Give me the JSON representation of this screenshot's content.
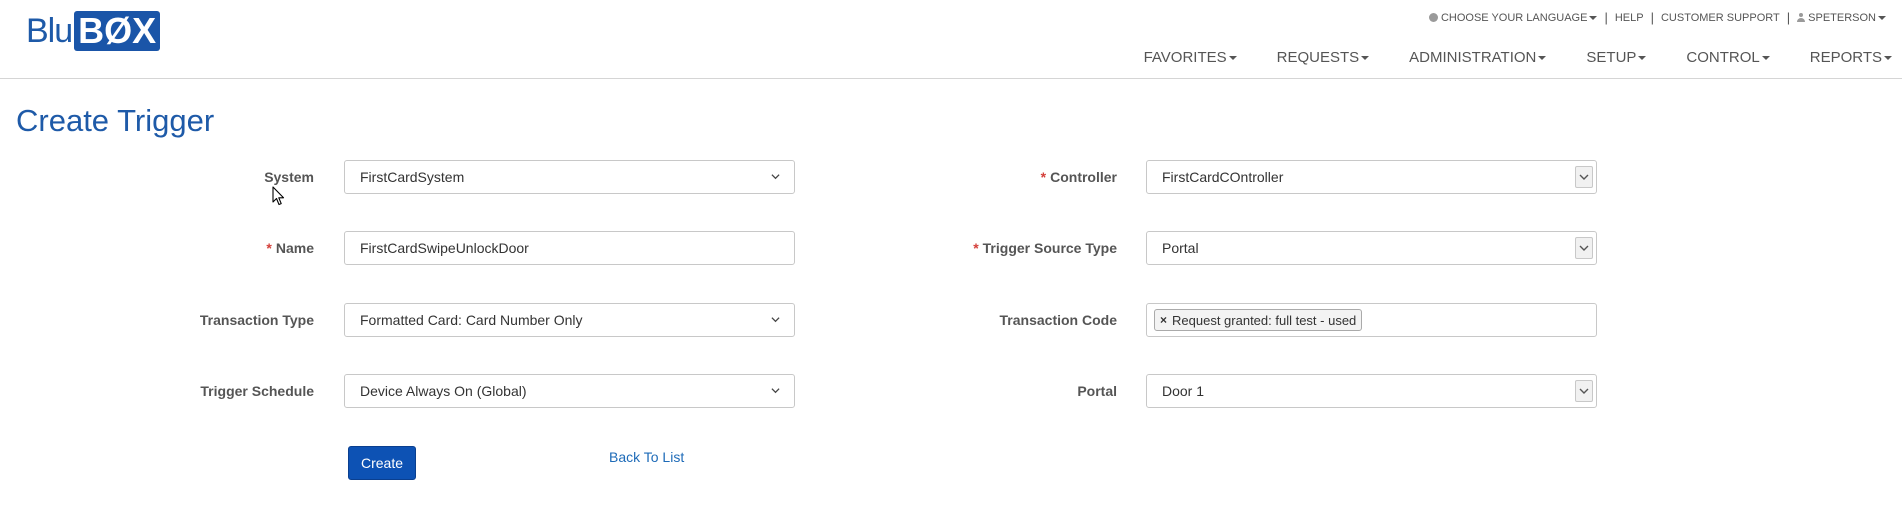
{
  "app": {
    "logo_left": "Blu",
    "logo_right": "BØX"
  },
  "utility_nav": {
    "language": "CHOOSE YOUR LANGUAGE",
    "help": "HELP",
    "support": "CUSTOMER SUPPORT",
    "user": "SPETERSON"
  },
  "main_nav": [
    "FAVORITES",
    "REQUESTS",
    "ADMINISTRATION",
    "SETUP",
    "CONTROL",
    "REPORTS"
  ],
  "page": {
    "title": "Create Trigger"
  },
  "form": {
    "system": {
      "label": "System",
      "value": "FirstCardSystem"
    },
    "name": {
      "label": "Name",
      "required_mark": "*",
      "value": "FirstCardSwipeUnlockDoor"
    },
    "transaction_type": {
      "label": "Transaction Type",
      "value": "Formatted Card: Card Number Only"
    },
    "trigger_schedule": {
      "label": "Trigger Schedule",
      "value": "Device Always On (Global)"
    },
    "controller": {
      "label": "Controller",
      "required_mark": "*",
      "value": "FirstCardCOntroller"
    },
    "trigger_source_type": {
      "label": "Trigger Source Type",
      "required_mark": "*",
      "value": "Portal"
    },
    "transaction_code": {
      "label": "Transaction Code",
      "tag_remove": "×",
      "tag": "Request granted: full test - used"
    },
    "portal": {
      "label": "Portal",
      "value": "Door 1"
    }
  },
  "actions": {
    "create": "Create",
    "back": "Back To List"
  },
  "colors": {
    "brand": "#1e5aa8",
    "button": "#0d52b4",
    "required": "#d43f3a",
    "link": "#1e6bb8"
  },
  "icons": {
    "language": "globe-icon",
    "user": "user-icon",
    "dropdown": "chevron-down-icon",
    "cursor": "mouse-pointer-icon"
  }
}
